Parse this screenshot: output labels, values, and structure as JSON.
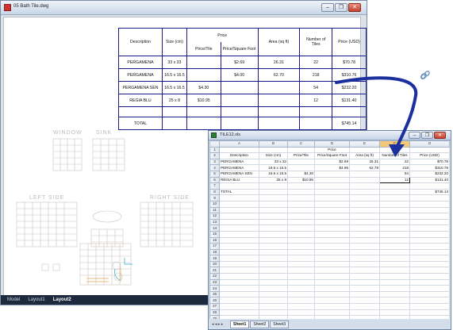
{
  "cad": {
    "title": "05 Bath Tile.dwg",
    "win_minimize": "–",
    "win_restore": "❐",
    "win_close": "✕",
    "tabs": [
      "Model",
      "Layout1",
      "Layout2"
    ],
    "active_tab": "Layout2",
    "table": {
      "headers": {
        "description": "Description",
        "size": "Size (cm)",
        "price": "Price",
        "price_tile": "Price/Tile",
        "price_sqft": "Price/Square Foot",
        "area": "Area (sq ft)",
        "num_tiles": "Number of Tiles",
        "price_usd": "Price (USD)"
      },
      "rows": [
        {
          "desc": "PERGAMENA",
          "size": "33 x 33",
          "ptile": "",
          "psqft": "$2.69",
          "area": "26.31",
          "num": "22",
          "usd": "$70.78"
        },
        {
          "desc": "PERGAMENA",
          "size": "16.5 x 16.5",
          "ptile": "",
          "psqft": "$4.00",
          "area": "62.70",
          "num": "218",
          "usd": "$310.76"
        },
        {
          "desc": "PERGAMENA SEN",
          "size": "16.5 x 16.5",
          "ptile": "$4.30",
          "psqft": "",
          "area": "",
          "num": "54",
          "usd": "$232.20"
        },
        {
          "desc": "REGIA BLU",
          "size": "25 x 8",
          "ptile": "$10.95",
          "psqft": "",
          "area": "",
          "num": "12",
          "usd": "$131.40"
        }
      ],
      "total_label": "TOTAL",
      "total_value": "$745.14"
    },
    "plan_labels": {
      "left_side": "LEFT SIDE",
      "right_side": "RIGHT SIDE",
      "top_left": "WINDOW",
      "top_right": "SINK"
    }
  },
  "excel": {
    "title": "TILE12.xls",
    "columns": [
      "A",
      "B",
      "C",
      "D",
      "E",
      "F",
      "G"
    ],
    "selected_column": "F",
    "rows": [
      {
        "n": "1",
        "cells": [
          "",
          "",
          "",
          "Price",
          "",
          "",
          ""
        ]
      },
      {
        "n": "2",
        "cells": [
          "Description",
          "Size (cm)",
          "Price/Tile",
          "Price/Square Foot",
          "Area (sq ft)",
          "Number of Tiles",
          "Price (USD)"
        ]
      },
      {
        "n": "3",
        "cells": [
          "PERGAMENA",
          "33 x 33",
          "",
          "$2.69",
          "26.31",
          "22",
          "$70.78"
        ]
      },
      {
        "n": "4",
        "cells": [
          "PERGAMENA",
          "16.5 x 16.5",
          "",
          "$4.95",
          "62.78",
          "218",
          "$310.76"
        ]
      },
      {
        "n": "5",
        "cells": [
          "PERGAMENA SEN",
          "16.5 x 16.5",
          "$4.30",
          "",
          "",
          "54",
          "$232.20"
        ]
      },
      {
        "n": "6",
        "cells": [
          "REGIA BLU",
          "25 x 8",
          "$10.95",
          "",
          "",
          "12",
          "$131.40"
        ]
      },
      {
        "n": "7",
        "cells": [
          "",
          "",
          "",
          "",
          "",
          "",
          ""
        ]
      },
      {
        "n": "8",
        "cells": [
          "TOTAL",
          "",
          "",
          "",
          "",
          "",
          "$745.14"
        ]
      }
    ],
    "empty_row_numbers": [
      "9",
      "10",
      "11",
      "12",
      "13",
      "14",
      "15",
      "16",
      "17",
      "18",
      "19",
      "20",
      "21",
      "22",
      "23",
      "24",
      "25",
      "26",
      "27",
      "28",
      "29"
    ],
    "sheets": [
      "Sheet1",
      "Sheet2",
      "Sheet3"
    ],
    "active_sheet": "Sheet1",
    "sheet_nav": "◂ ◂ ▸ ▸"
  }
}
